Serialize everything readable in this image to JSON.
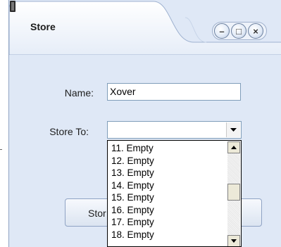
{
  "window": {
    "title": "Store",
    "controls": {
      "minimize": "–",
      "maximize": "□",
      "close": "×"
    }
  },
  "form": {
    "name_label": "Name:",
    "name_value": "Xover",
    "store_to_label": "Store To:",
    "store_to_value": ""
  },
  "button": {
    "partial_label": "Stor"
  },
  "dropdown": {
    "items": [
      "11. Empty",
      "12. Empty",
      "13. Empty",
      "14. Empty",
      "15. Empty",
      "16. Empty",
      "17. Empty",
      "18. Empty"
    ]
  },
  "colors": {
    "window_bg": "#dfe8f6",
    "border": "#7f9db9"
  }
}
